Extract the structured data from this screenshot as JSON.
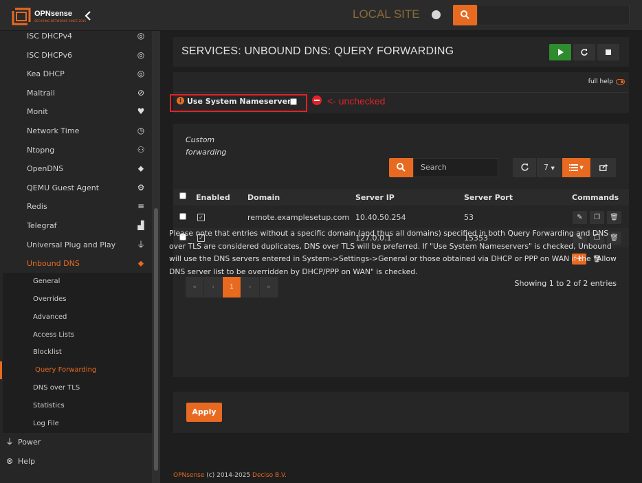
{
  "header": {
    "logo_text": "OPNsense",
    "logo_tagline": "SECURING NETWORKS SINCE 2015",
    "site_name": "LOCAL SITE",
    "search_placeholder": ""
  },
  "sidebar": {
    "items": [
      {
        "label": "ISC DHCPv4",
        "icon": "target-icon",
        "glyph": "◎"
      },
      {
        "label": "ISC DHCPv6",
        "icon": "target-icon",
        "glyph": "◎"
      },
      {
        "label": "Kea DHCP",
        "icon": "target-icon",
        "glyph": "◎"
      },
      {
        "label": "Maltrail",
        "icon": "eye-slash-icon",
        "glyph": "⊘"
      },
      {
        "label": "Monit",
        "icon": "heartbeat-icon",
        "glyph": "♥"
      },
      {
        "label": "Network Time",
        "icon": "clock-icon",
        "glyph": "◷"
      },
      {
        "label": "Ntopng",
        "icon": "binoculars-icon",
        "glyph": "⚇"
      },
      {
        "label": "OpenDNS",
        "icon": "tags-icon",
        "glyph": "⬥"
      },
      {
        "label": "QEMU Guest Agent",
        "icon": "gear-icon",
        "glyph": "⚙"
      },
      {
        "label": "Redis",
        "icon": "database-icon",
        "glyph": "≡"
      },
      {
        "label": "Telegraf",
        "icon": "area-chart-icon",
        "glyph": "▟"
      },
      {
        "label": "Universal Plug and Play",
        "icon": "plug-icon",
        "glyph": "⏚"
      }
    ],
    "active": {
      "label": "Unbound DNS",
      "icon": "tags-icon",
      "glyph": "⬥"
    },
    "subitems": [
      "General",
      "Overrides",
      "Advanced",
      "Access Lists",
      "Blocklist",
      "Query Forwarding",
      "DNS over TLS",
      "Statistics",
      "Log File"
    ],
    "current_subitem": "Query Forwarding",
    "bottom": [
      {
        "label": "Power",
        "icon": "plug-icon",
        "glyph": "⏚"
      },
      {
        "label": "Help",
        "icon": "life-ring-icon",
        "glyph": "⊗"
      }
    ]
  },
  "page": {
    "title": "SERVICES: UNBOUND DNS: QUERY FORWARDING",
    "full_help": "full help",
    "use_system_nameservers": "Use System Nameservers",
    "annotation": "<- unchecked"
  },
  "grid": {
    "title": "Custom forwarding",
    "search_placeholder": "Search",
    "page_size": "7",
    "columns": [
      "Enabled",
      "Domain",
      "Server IP",
      "Server Port",
      "Commands"
    ],
    "rows": [
      {
        "enabled": true,
        "domain": "remote.examplesetup.com",
        "server_ip": "10.40.50.254",
        "server_port": "53"
      },
      {
        "enabled": true,
        "domain": "",
        "server_ip": "127.0.0.1",
        "server_port": "15353"
      }
    ],
    "pager": [
      "«",
      "‹",
      "1",
      "›",
      "»"
    ],
    "showing": "Showing 1 to 2 of 2 entries",
    "note": "Please note that entries without a specific domain (and thus all domains) specified in both Query Forwarding and DNS over TLS are considered duplicates, DNS over TLS will be preferred. If \"Use System Nameservers\" is checked, Unbound will use the DNS servers entered in System->Settings->General or those obtained via DHCP or PPP on WAN if the \"Allow DNS server list to be overridden by DHCP/PPP on WAN\" is checked."
  },
  "apply_label": "Apply",
  "footer": {
    "brand": "OPNsense",
    "copyright": " (c) 2014-2025 ",
    "company": "Deciso B.V."
  },
  "colors": {
    "accent": "#e86a21",
    "success": "#2e8b2e",
    "annotation": "#e0232b"
  }
}
